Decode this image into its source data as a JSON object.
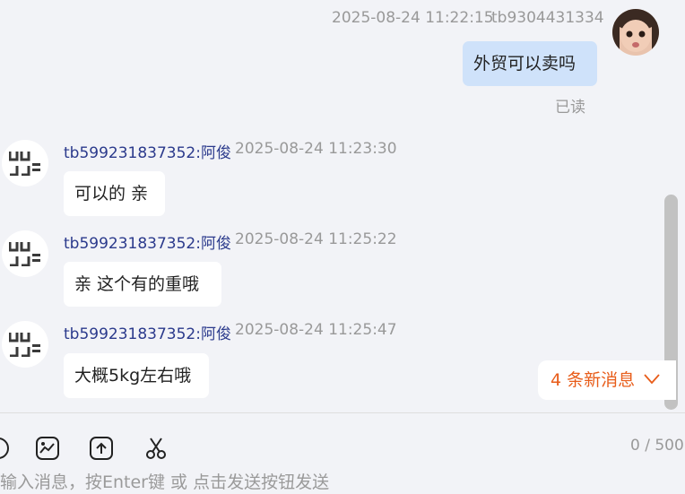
{
  "messages": [
    {
      "direction": "out",
      "timestamp": "2025-08-24 11:22:15",
      "sender": "tb9304431334",
      "text": "外贸可以卖吗",
      "receipt": "已读"
    },
    {
      "direction": "in",
      "sender": "tb599231837352:阿俊",
      "timestamp": "2025-08-24 11:23:30",
      "text": "可以的 亲"
    },
    {
      "direction": "in",
      "sender": "tb599231837352:阿俊",
      "timestamp": "2025-08-24 11:25:22",
      "text": "亲 这个有的重哦"
    },
    {
      "direction": "in",
      "sender": "tb599231837352:阿俊",
      "timestamp": "2025-08-24 11:25:47",
      "text": "大概5kg左右哦"
    }
  ],
  "new_messages_badge": "4 条新消息",
  "toolbar": {
    "icons": [
      "emoji-icon",
      "image-icon",
      "upload-icon",
      "scissors-icon"
    ],
    "char_counter": "0 / 500"
  },
  "input": {
    "placeholder": "输入消息，按Enter键 或 点击发送按钮发送"
  },
  "colors": {
    "background": "#f2f3f7",
    "outgoing_bubble": "#cfe2fa",
    "incoming_bubble": "#ffffff",
    "sender_name": "#2b3a8c",
    "new_msg_accent": "#e85d1a"
  }
}
